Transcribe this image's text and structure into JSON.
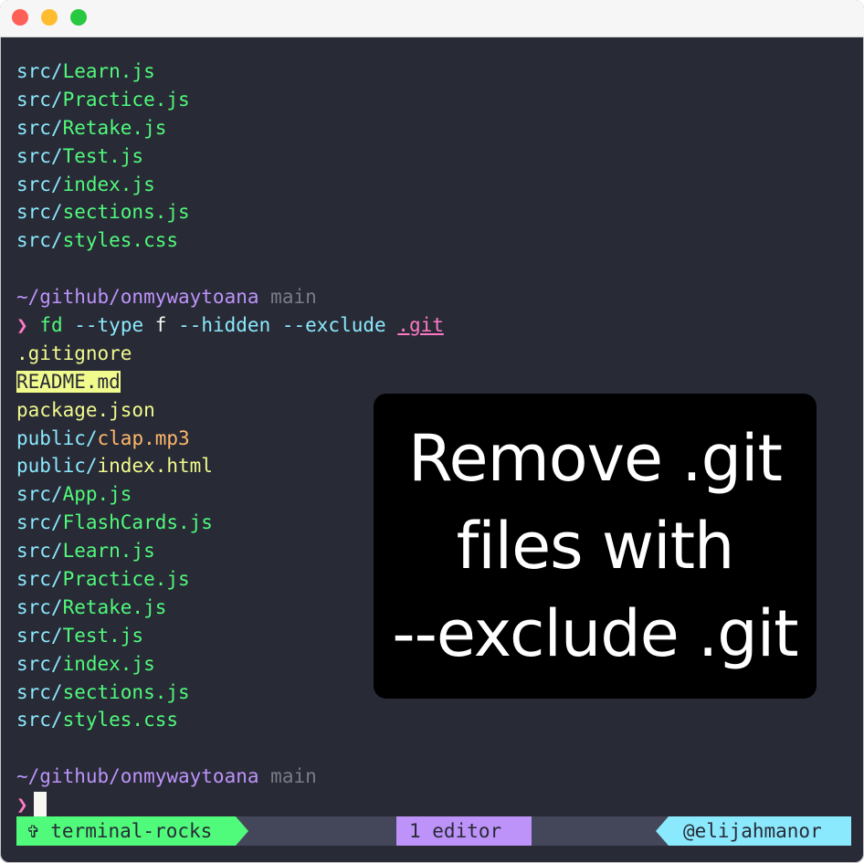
{
  "window": {
    "traffic_lights": [
      "close",
      "minimize",
      "maximize"
    ]
  },
  "terminal": {
    "prev_output": [
      {
        "dir": "src/",
        "file": "Learn.js"
      },
      {
        "dir": "src/",
        "file": "Practice.js"
      },
      {
        "dir": "src/",
        "file": "Retake.js"
      },
      {
        "dir": "src/",
        "file": "Test.js"
      },
      {
        "dir": "src/",
        "file": "index.js"
      },
      {
        "dir": "src/",
        "file": "sections.js"
      },
      {
        "dir": "src/",
        "file": "styles.css"
      }
    ],
    "prompt1": {
      "path": "~/github/onmywaytoana",
      "branch": "main",
      "symbol": "❯",
      "cmd": "fd",
      "args": " --type ",
      "arg_value": "f",
      "args2": " --hidden --exclude ",
      "pattern": ".git"
    },
    "output": [
      {
        "dir": "",
        "file": ".gitignore"
      },
      {
        "dir": "",
        "file": "README.md"
      },
      {
        "dir": "",
        "file": "package.json"
      },
      {
        "dir": "public/",
        "file": "clap.mp3"
      },
      {
        "dir": "public/",
        "file": "index.html"
      },
      {
        "dir": "src/",
        "file": "App.js"
      },
      {
        "dir": "src/",
        "file": "FlashCards.js"
      },
      {
        "dir": "src/",
        "file": "Learn.js"
      },
      {
        "dir": "src/",
        "file": "Practice.js"
      },
      {
        "dir": "src/",
        "file": "Retake.js"
      },
      {
        "dir": "src/",
        "file": "Test.js"
      },
      {
        "dir": "src/",
        "file": "index.js"
      },
      {
        "dir": "src/",
        "file": "sections.js"
      },
      {
        "dir": "src/",
        "file": "styles.css"
      }
    ],
    "prompt2": {
      "path": "~/github/onmywaytoana",
      "branch": "main",
      "symbol": "❯"
    }
  },
  "statusbar": {
    "left": "✞ terminal-rocks",
    "middle": "1 editor",
    "right": "@elijahmanor"
  },
  "overlay": {
    "lines": [
      "Remove .git",
      "files with",
      "--exclude .git"
    ]
  },
  "colors": {
    "background": "#282a36",
    "cyan": "#8be9fd",
    "green": "#50fa7b",
    "yellow": "#f1fa8c",
    "orange": "#ffb86c",
    "purple": "#bd93f9",
    "pink": "#ff79c6"
  }
}
